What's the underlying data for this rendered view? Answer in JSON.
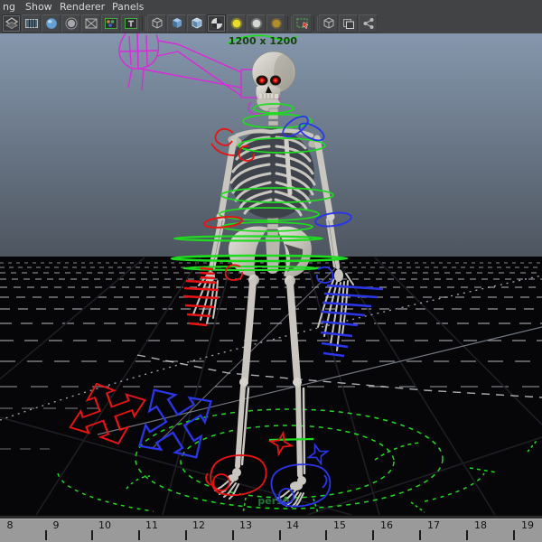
{
  "menu_bar": {
    "items": [
      "ng",
      "Show",
      "Renderer",
      "Panels"
    ]
  },
  "toolbar": {
    "buttons": [
      "select-highlight",
      "film-grid",
      "smooth-shade-all",
      "flat-shade-all",
      "wireframe",
      "shaded-textured",
      "textured-labels",
      "default-material-cube",
      "smooth-cube",
      "high-quality-cube",
      "checker-sphere",
      "light-yellow",
      "light-default",
      "light-gold",
      "isolate-select",
      "wire-cube",
      "xray-overlap",
      "node-connections"
    ]
  },
  "viewport": {
    "resolution_gate_label": "1200 x 1200",
    "camera_label": "persp"
  },
  "timeline": {
    "frame_labels": [
      "8",
      "9",
      "10",
      "11",
      "12",
      "13",
      "14",
      "15",
      "16",
      "17",
      "18",
      "19"
    ]
  },
  "colors": {
    "chrome_bg": "#414345",
    "sky_top": "#8597ad",
    "sky_bottom": "#4d555f",
    "floor": "#060609",
    "grid_dash": "#cdd0d5",
    "control_green": "#1edc1e",
    "control_red": "#e81414",
    "control_blue": "#2a36e8",
    "control_magenta": "#d92ad9",
    "bone": "#c9c6bf",
    "gate_text": "#15400f",
    "camera_text": "#1e7a33",
    "timeline_bg": "#9a9a9a"
  }
}
